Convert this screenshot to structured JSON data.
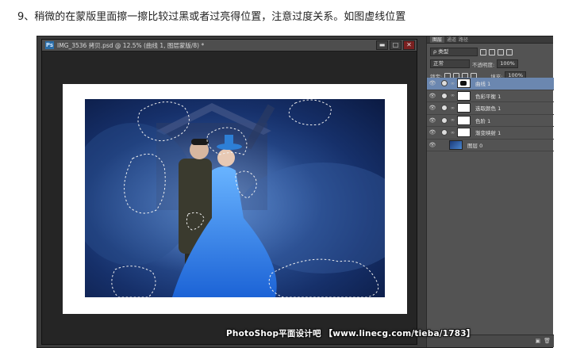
{
  "instruction": "9、稍微的在蒙版里面擦一擦比较过黑或者过亮得位置，注意过度关系。如图虚线位置",
  "document": {
    "title": "IMG_3536 拷贝.psd @ 12.5% (曲线 1, 图层蒙版/8) *",
    "buttons": {
      "minimize": "▬",
      "maximize": "□",
      "close": "✕"
    }
  },
  "layers_panel": {
    "tabs": [
      "图层",
      "通道",
      "路径"
    ],
    "filter_label": "ρ 类型",
    "blend_mode": "正常",
    "opacity_label": "不透明度:",
    "opacity_value": "100%",
    "lock_label": "锁定:",
    "fill_label": "填充:",
    "fill_value": "100%",
    "layers": [
      {
        "name": "曲线 1",
        "selected": true
      },
      {
        "name": "色彩平衡 1",
        "selected": false
      },
      {
        "name": "选取颜色 1",
        "selected": false
      },
      {
        "name": "色阶 1",
        "selected": false
      },
      {
        "name": "渐变映射 1",
        "selected": false
      },
      {
        "name": "图层 0",
        "selected": false
      }
    ]
  },
  "watermark": "PhotoShop平面设计吧 【www.linecg.com/tieba/1783】",
  "colors": {
    "selected_layer": "#6b87b0",
    "panel_bg": "#535353",
    "workspace": "#252525"
  }
}
